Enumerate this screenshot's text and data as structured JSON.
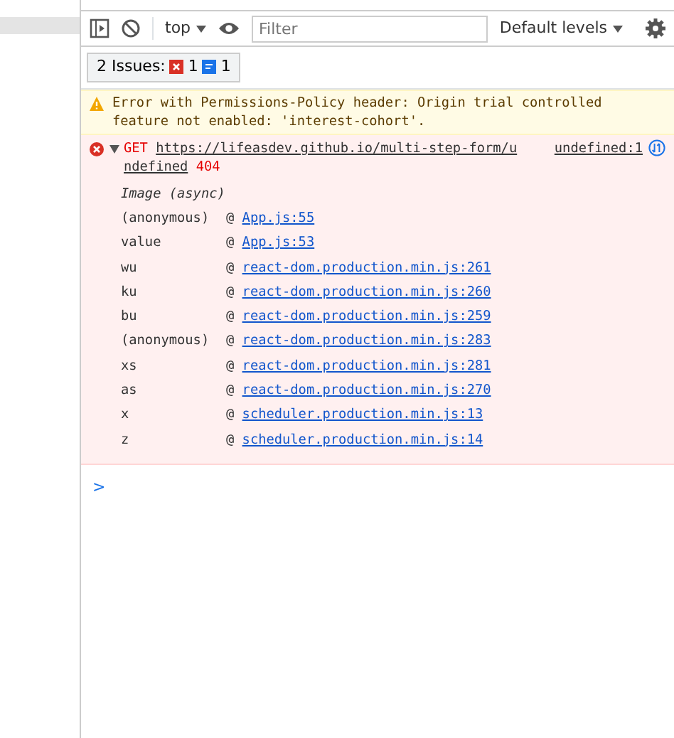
{
  "toolbar": {
    "context": "top",
    "filter_placeholder": "Filter",
    "levels": "Default levels"
  },
  "issues": {
    "label": "2 Issues:",
    "errors": "1",
    "infos": "1"
  },
  "messages": [
    {
      "kind": "warning",
      "text": "Error with Permissions-Policy header: Origin trial controlled feature not enabled: 'interest-cohort'."
    },
    {
      "kind": "error",
      "method": "GET",
      "url": [
        "https://lifeasdev.github.io/multi-step-form/u",
        "ndefined"
      ],
      "status": "404",
      "source": "undefined:1",
      "expanded": true,
      "stack_title": "Image (async)",
      "stack": [
        {
          "fn": "(anonymous)",
          "at": "@",
          "loc": "App.js:55"
        },
        {
          "fn": "value",
          "at": "@",
          "loc": "App.js:53"
        },
        {
          "fn": "wu",
          "at": "@",
          "loc": "react-dom.production.min.js:261"
        },
        {
          "fn": "ku",
          "at": "@",
          "loc": "react-dom.production.min.js:260"
        },
        {
          "fn": "bu",
          "at": "@",
          "loc": "react-dom.production.min.js:259"
        },
        {
          "fn": "(anonymous)",
          "at": "@",
          "loc": "react-dom.production.min.js:283"
        },
        {
          "fn": "xs",
          "at": "@",
          "loc": "react-dom.production.min.js:281"
        },
        {
          "fn": "as",
          "at": "@",
          "loc": "react-dom.production.min.js:270"
        },
        {
          "fn": "x",
          "at": "@",
          "loc": "scheduler.production.min.js:13"
        },
        {
          "fn": "z",
          "at": "@",
          "loc": "scheduler.production.min.js:14"
        }
      ]
    }
  ],
  "prompt": ">"
}
